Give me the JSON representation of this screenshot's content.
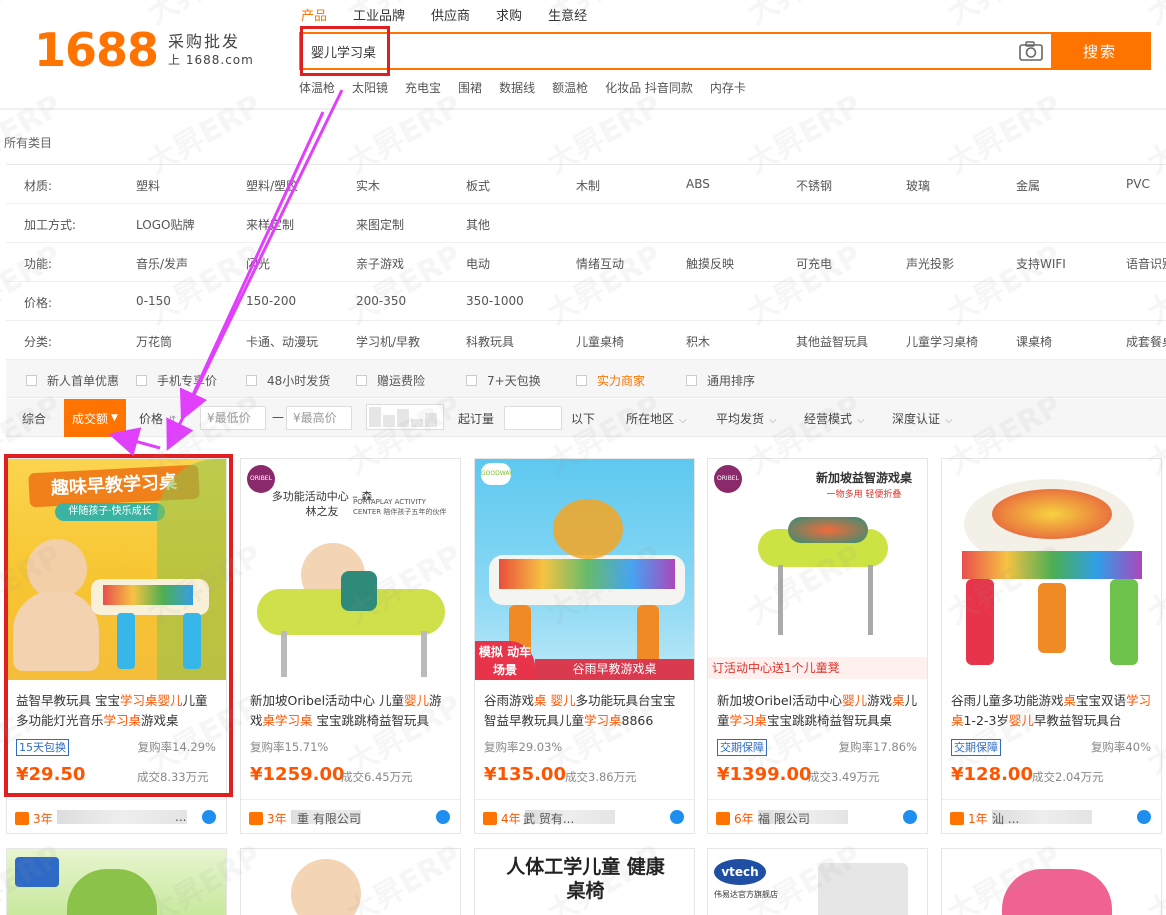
{
  "search": {
    "tabs": [
      "产品",
      "工业品牌",
      "供应商",
      "求购",
      "生意经"
    ],
    "query": "婴儿学习桌",
    "button": "搜索",
    "hot": [
      "体温枪",
      "太阳镜",
      "充电宝",
      "围裙",
      "数据线",
      "额温枪",
      "化妆品 抖音同款",
      "内存卡"
    ]
  },
  "logo": {
    "num": "1688",
    "slogan": "采购批发",
    "url": "上 1688.com"
  },
  "all_categories": "所有类目",
  "filters": [
    {
      "label": "材质:",
      "values": [
        "塑料",
        "塑料/塑胶",
        "实木",
        "板式",
        "木制",
        "ABS",
        "不锈钢",
        "玻璃",
        "金属",
        "PVC"
      ]
    },
    {
      "label": "加工方式:",
      "values": [
        "LOGO贴牌",
        "来样定制",
        "来图定制",
        "其他"
      ]
    },
    {
      "label": "功能:",
      "values": [
        "音乐/发声",
        "闪光",
        "亲子游戏",
        "电动",
        "情绪互动",
        "触摸反映",
        "可充电",
        "声光投影",
        "支持WIFI",
        "语音识别"
      ]
    },
    {
      "label": "价格:",
      "values": [
        "0-150",
        "150-200",
        "200-350",
        "350-1000"
      ]
    },
    {
      "label": "分类:",
      "values": [
        "万花筒",
        "卡通、动漫玩",
        "学习机/早教",
        "科教玩具",
        "儿童桌椅",
        "积木",
        "其他益智玩具",
        "儿童学习桌椅",
        "课桌椅",
        "成套餐桌"
      ]
    }
  ],
  "checks": [
    "新人首单优惠",
    "手机专享价",
    "48小时发货",
    "赠运费险",
    "7+天包换",
    "实力商家",
    "通用排序"
  ],
  "sort": {
    "items": [
      "综合",
      "成交额",
      "价格",
      "¥最低价",
      "¥最高价",
      "起订量",
      "以下",
      "所在地区",
      "平均发货",
      "经营模式",
      "深度认证"
    ],
    "dash": "—"
  },
  "products": [
    {
      "img_title": "趣味早教学习桌",
      "img_sub": "伴随孩子·快乐成长",
      "title_parts": [
        "益智早教玩具 宝宝",
        "学习桌",
        "",
        "婴儿",
        "儿童多功能灯光音乐",
        "学习桌",
        "游戏桌"
      ],
      "badge": "15天包换",
      "repeat": "复购率14.29%",
      "price": "¥29.50",
      "sold": "成交8.33万元",
      "years": "3年",
      "supplier": "..."
    },
    {
      "img_brand": "ORIBEL",
      "img_title": "多功能活动中心 – 森林之友",
      "img_sub": "PORTAPLAY ACTIVITY CENTER 陪伴孩子五年的伙伴",
      "title_parts": [
        "新加坡Oribel活动中心 儿童",
        "婴儿",
        "游戏",
        "桌",
        "",
        "学习桌",
        " 宝宝跳跳椅益智玩具"
      ],
      "badge": "",
      "repeat": "复购率15.71%",
      "price": "¥1259.00",
      "sold": "成交6.45万元",
      "years": "3年",
      "supplier": "重 有限公司"
    },
    {
      "img_brand": "GOODWAY",
      "img_title": "模拟 动车场景",
      "img_sub": "谷雨早教游戏桌",
      "title_parts": [
        "谷雨游戏",
        "桌",
        " ",
        "婴儿",
        "多功能玩具台宝宝智益早教玩具儿童",
        "学习桌",
        "8866"
      ],
      "badge": "",
      "repeat": "复购率29.03%",
      "price": "¥135.00",
      "sold": "成交3.86万元",
      "years": "4年",
      "supplier": "武 贸有..."
    },
    {
      "img_brand": "ORIBEL",
      "img_title": "新加坡益智游戏桌",
      "img_sub": "一物多用 轻便折叠",
      "img_banner": "订活动中心送1个儿童凳",
      "title_parts": [
        "新加坡Oribel活动中心",
        "婴儿",
        "游戏",
        "桌",
        "儿童",
        "学习桌",
        "宝宝跳跳椅益智玩具桌"
      ],
      "badge": "交期保障",
      "repeat": "复购率17.86%",
      "price": "¥1399.00",
      "sold": "成交3.49万元",
      "years": "6年",
      "supplier": "福 限公司"
    },
    {
      "title_parts": [
        "谷雨儿童多功能游戏",
        "桌",
        "宝宝双语",
        "学习桌",
        "1-2-3岁",
        "婴儿",
        "早教益智玩具台"
      ],
      "badge": "交期保障",
      "repeat": "复购率40%",
      "price": "¥128.00",
      "sold": "成交2.04万元",
      "years": "1年",
      "supplier": "汕 ..."
    }
  ],
  "row2": {
    "p3_title": "人体工学儿童 健康桌椅",
    "p4_brand": "vtech",
    "p4_sub": "伟易达官方旗舰店"
  },
  "colors": {
    "accent": "#ff7300",
    "price": "#ff5500",
    "annotation_red": "#e02020",
    "arrow": "#e040fb"
  },
  "watermark": "大昇ERP"
}
